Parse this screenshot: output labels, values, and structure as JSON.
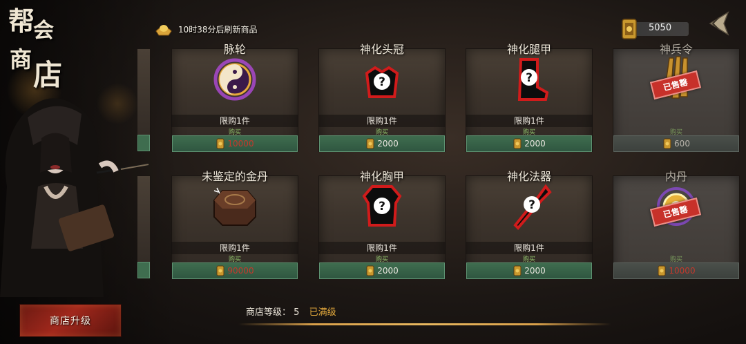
{
  "shop": {
    "title_chars": [
      "帮",
      "会",
      "商",
      "店"
    ],
    "refresh_text": "10时38分后刷新商品",
    "currency_value": "5050",
    "buy_label": "购买",
    "sold_label": "已售罄",
    "upgrade_label": "商店升级",
    "level_label": "商店等级：",
    "level_value": "5",
    "level_status": "已满级"
  },
  "items": [
    {
      "name": "脉轮",
      "limit": "限购1件",
      "price": "10000",
      "price_color": "#c3392c",
      "sold": false,
      "icon": "chakra-orb-icon"
    },
    {
      "name": "神化头冠",
      "limit": "限购1件",
      "price": "2000",
      "price_color": "#e9e6df",
      "sold": false,
      "icon": "unknown-helmet-icon"
    },
    {
      "name": "神化腿甲",
      "limit": "限购1件",
      "price": "2000",
      "price_color": "#e9e6df",
      "sold": false,
      "icon": "unknown-boots-icon"
    },
    {
      "name": "神兵令",
      "limit": "",
      "price": "600",
      "price_color": "#b8b3aa",
      "sold": true,
      "icon": "weapon-token-icon"
    },
    {
      "name": "未鉴定的金丹",
      "limit": "限购1件",
      "price": "90000",
      "price_color": "#c3392c",
      "sold": false,
      "icon": "golden-elixir-box-icon"
    },
    {
      "name": "神化胸甲",
      "limit": "限购1件",
      "price": "2000",
      "price_color": "#e9e6df",
      "sold": false,
      "icon": "unknown-chest-armor-icon"
    },
    {
      "name": "神化法器",
      "limit": "限购1件",
      "price": "2000",
      "price_color": "#e9e6df",
      "sold": false,
      "icon": "unknown-artifact-icon"
    },
    {
      "name": "内丹",
      "limit": "",
      "price": "10000",
      "price_color": "#c3392c",
      "sold": true,
      "icon": "inner-elixir-orb-icon"
    }
  ]
}
